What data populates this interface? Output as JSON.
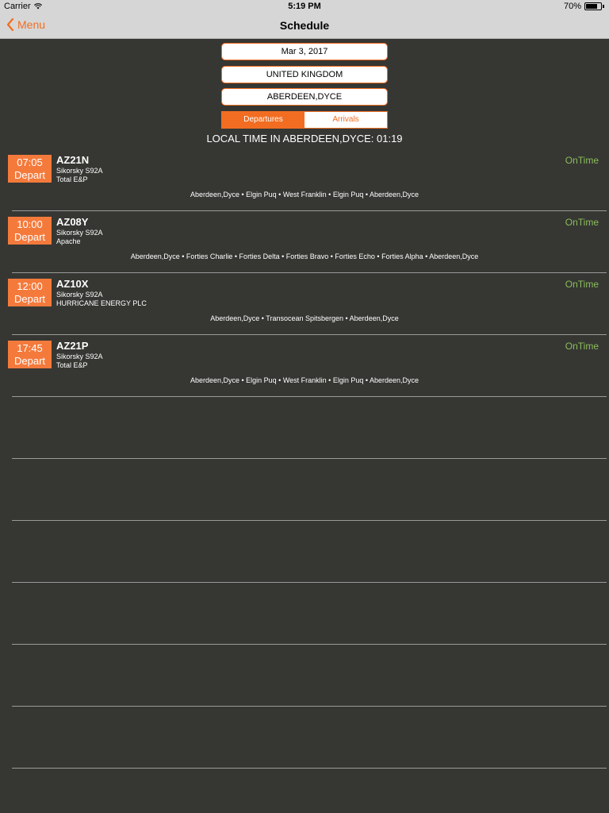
{
  "status_bar": {
    "carrier": "Carrier",
    "time": "5:19 PM",
    "battery": "70%",
    "battery_level": 0.7
  },
  "nav": {
    "back_label": "Menu",
    "title": "Schedule"
  },
  "filters": {
    "date": "Mar 3, 2017",
    "country": "UNITED KINGDOM",
    "airport": "ABERDEEN,DYCE",
    "segments": [
      "Departures",
      "Arrivals"
    ],
    "selected_segment": "Departures"
  },
  "local_time_text": "LOCAL TIME IN ABERDEEN,DYCE: 01:19",
  "flights": [
    {
      "time": "07:05",
      "type": "Depart",
      "code": "AZ21N",
      "aircraft": "Sikorsky S92A",
      "operator": "Total E&P",
      "status": "OnTime",
      "route": "Aberdeen,Dyce • Elgin Puq • West Franklin • Elgin Puq • Aberdeen,Dyce"
    },
    {
      "time": "10:00",
      "type": "Depart",
      "code": "AZ08Y",
      "aircraft": "Sikorsky S92A",
      "operator": "Apache",
      "status": "OnTime",
      "route": "Aberdeen,Dyce • Forties Charlie • Forties Delta • Forties Bravo • Forties Echo • Forties Alpha • Aberdeen,Dyce"
    },
    {
      "time": "12:00",
      "type": "Depart",
      "code": "AZ10X",
      "aircraft": "Sikorsky S92A",
      "operator": "HURRICANE ENERGY PLC",
      "status": "OnTime",
      "route": "Aberdeen,Dyce • Transocean Spitsbergen • Aberdeen,Dyce"
    },
    {
      "time": "17:45",
      "type": "Depart",
      "code": "AZ21P",
      "aircraft": "Sikorsky S92A",
      "operator": "Total E&P",
      "status": "OnTime",
      "route": "Aberdeen,Dyce • Elgin Puq • West Franklin • Elgin Puq • Aberdeen,Dyce"
    }
  ],
  "colors": {
    "accent": "#f26d21",
    "badge": "#f47a3c",
    "background": "#363733",
    "status_ok": "#8bbd5a"
  }
}
